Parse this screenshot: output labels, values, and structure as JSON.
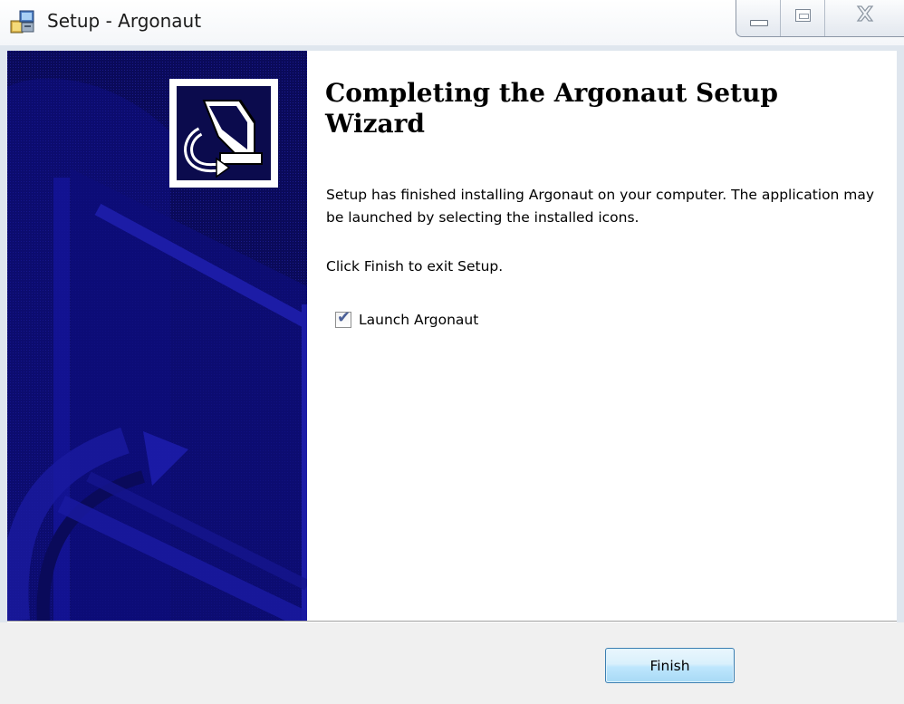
{
  "window": {
    "title": "Setup - Argonaut"
  },
  "caption": {
    "minimize_icon": "minimize-icon",
    "maximize_icon": "maximize-icon",
    "close_icon": "close-icon",
    "close_glyph": "☒"
  },
  "banner": {
    "logo_icon": "installer-computer-icon",
    "background_color": "#0a0a5a"
  },
  "content": {
    "heading": "Completing the Argonaut Setup Wizard",
    "description": "Setup has finished installing Argonaut on your computer. The application may be launched by selecting the installed icons.",
    "click_finish": "Click Finish to exit Setup.",
    "launch_checkbox": {
      "label": "Launch Argonaut",
      "checked": true
    }
  },
  "footer": {
    "finish_label": "Finish"
  }
}
